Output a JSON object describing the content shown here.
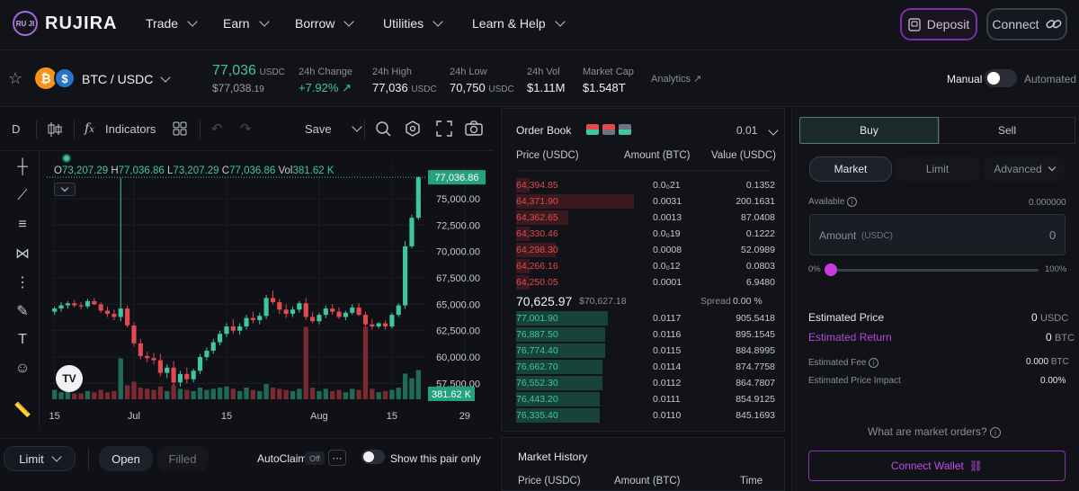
{
  "brand": {
    "name": "RUJIRA",
    "mark": "RU JI"
  },
  "nav": [
    {
      "label": "Trade"
    },
    {
      "label": "Earn"
    },
    {
      "label": "Borrow"
    },
    {
      "label": "Utilities"
    },
    {
      "label": "Learn & Help"
    }
  ],
  "header_buttons": {
    "deposit": "Deposit",
    "connect": "Connect"
  },
  "pair": {
    "name": "BTC / USDC"
  },
  "ticker": {
    "price": "77,036",
    "price_unit": "USDC",
    "price_sub": "$77,038.",
    "price_sub_small": "19",
    "change_label": "24h Change",
    "change_value": "+7.92%",
    "high_label": "24h High",
    "high_value": "77,036",
    "high_unit": "USDC",
    "low_label": "24h Low",
    "low_value": "70,750",
    "low_unit": "USDC",
    "vol_label": "24h Vol",
    "vol_value": "$1.11M",
    "mcap_label": "Market Cap",
    "mcap_value": "$1.548T",
    "analytics": "Analytics",
    "manual": "Manual",
    "automated": "Automated"
  },
  "chart_toolbar": {
    "interval": "D",
    "indicators": "Indicators",
    "save": "Save"
  },
  "chart_legend": {
    "o_label": "O",
    "o": "73,207.29",
    "h_label": "H",
    "h": "77,036.86",
    "l_label": "L",
    "l": "73,207.29",
    "c_label": "C",
    "c": "77,036.86",
    "vol_label": "Vol",
    "vol": "381.62 K"
  },
  "chart_data": {
    "type": "candlestick",
    "y_ticks": [
      "75,000.00",
      "72,500.00",
      "70,000.00",
      "67,500.00",
      "65,000.00",
      "62,500.00",
      "60,000.00",
      "57,500.00"
    ],
    "y_tick_values": [
      75000,
      72500,
      70000,
      67500,
      65000,
      62500,
      60000,
      57500
    ],
    "ylim": [
      56000,
      78500
    ],
    "x_ticks": [
      "15",
      "Jul",
      "15",
      "Aug",
      "15",
      "29"
    ],
    "last_price_label": "77,036.86",
    "volume_label": "381.62 K",
    "candles": [
      [
        64300,
        64800,
        64000,
        64600
      ],
      [
        64600,
        65200,
        64300,
        64900
      ],
      [
        64900,
        65300,
        64600,
        65100
      ],
      [
        65100,
        65400,
        64700,
        64900
      ],
      [
        64900,
        65200,
        64500,
        64800
      ],
      [
        64800,
        65500,
        64600,
        65300
      ],
      [
        65300,
        65600,
        64900,
        65000
      ],
      [
        65000,
        65200,
        64200,
        64400
      ],
      [
        64400,
        64800,
        63800,
        64100
      ],
      [
        64100,
        64500,
        63500,
        63800
      ],
      [
        63800,
        77000,
        63400,
        64600
      ],
      [
        64600,
        64900,
        62800,
        63000
      ],
      [
        63000,
        63300,
        61000,
        61300
      ],
      [
        61300,
        61700,
        59800,
        60100
      ],
      [
        60100,
        60500,
        59500,
        59900
      ],
      [
        59900,
        60400,
        59300,
        59700
      ],
      [
        59700,
        60300,
        58200,
        58500
      ],
      [
        58500,
        59300,
        58000,
        59000
      ],
      [
        59000,
        59600,
        57300,
        57600
      ],
      [
        57600,
        58700,
        57200,
        58400
      ],
      [
        58400,
        59000,
        57500,
        57900
      ],
      [
        57900,
        58900,
        57600,
        58700
      ],
      [
        58700,
        60300,
        58400,
        60000
      ],
      [
        60000,
        60900,
        59700,
        60600
      ],
      [
        60600,
        61700,
        60300,
        61400
      ],
      [
        61400,
        62500,
        61100,
        62200
      ],
      [
        62200,
        63200,
        61900,
        62900
      ],
      [
        62900,
        63600,
        62200,
        62500
      ],
      [
        62500,
        63200,
        62100,
        62900
      ],
      [
        62900,
        64000,
        62600,
        63700
      ],
      [
        63700,
        64300,
        63200,
        63500
      ],
      [
        63500,
        64200,
        63100,
        63900
      ],
      [
        63900,
        65900,
        63600,
        65600
      ],
      [
        65600,
        66300,
        65000,
        65200
      ],
      [
        65200,
        65500,
        64100,
        64500
      ],
      [
        64500,
        65000,
        63700,
        64100
      ],
      [
        64100,
        64800,
        63800,
        64500
      ],
      [
        64500,
        65300,
        64200,
        65100
      ],
      [
        65100,
        65600,
        63500,
        63800
      ],
      [
        63800,
        64300,
        63200,
        63400
      ],
      [
        63400,
        64200,
        63100,
        64000
      ],
      [
        64000,
        64900,
        63700,
        64600
      ],
      [
        64600,
        65000,
        64000,
        64300
      ],
      [
        64300,
        64700,
        63600,
        63800
      ],
      [
        63800,
        64400,
        63500,
        64200
      ],
      [
        64200,
        65000,
        64000,
        64700
      ],
      [
        64700,
        65100,
        63900,
        64000
      ],
      [
        64000,
        64300,
        62900,
        63100
      ],
      [
        63100,
        63600,
        62600,
        62900
      ],
      [
        62900,
        63300,
        62700,
        63200
      ],
      [
        63200,
        63500,
        62600,
        62900
      ],
      [
        62900,
        64200,
        62700,
        64000
      ],
      [
        64000,
        65100,
        63800,
        64900
      ],
      [
        64900,
        71000,
        64600,
        70500
      ],
      [
        70500,
        73500,
        70300,
        73200
      ],
      [
        73200,
        77100,
        73000,
        77036
      ]
    ],
    "volumes": [
      0.08,
      0.06,
      0.07,
      0.05,
      0.05,
      0.07,
      0.06,
      0.08,
      0.06,
      0.07,
      0.35,
      0.12,
      0.15,
      0.1,
      0.09,
      0.08,
      0.11,
      0.07,
      0.12,
      0.09,
      0.08,
      0.07,
      0.1,
      0.08,
      0.09,
      0.1,
      0.11,
      0.09,
      0.07,
      0.1,
      0.08,
      0.07,
      0.13,
      0.1,
      0.09,
      0.08,
      0.07,
      0.09,
      0.62,
      0.1,
      0.07,
      0.09,
      0.07,
      0.08,
      0.06,
      0.09,
      0.08,
      0.62,
      0.09,
      0.06,
      0.07,
      0.08,
      0.1,
      0.22,
      0.18,
      0.25
    ]
  },
  "bottom_bar": {
    "order_type": "Limit",
    "open": "Open",
    "filled": "Filled",
    "autoclaim": "AutoClaim",
    "autoclaim_state": "Off",
    "show_pair": "Show this pair only"
  },
  "order_book": {
    "title": "Order Book",
    "tick": "0.01",
    "headers": {
      "price": "Price (USDC)",
      "amount": "Amount (BTC)",
      "value": "Value (USDC)"
    },
    "asks": [
      {
        "price": "64,394.85",
        "amount": "0.0₀21",
        "value": "0.1352",
        "depth": 0.05
      },
      {
        "price": "64,371.90",
        "amount": "0.0031",
        "value": "200.1631",
        "depth": 0.45
      },
      {
        "price": "64,362.65",
        "amount": "0.0013",
        "value": "87.0408",
        "depth": 0.2
      },
      {
        "price": "64,330.46",
        "amount": "0.0₀19",
        "value": "0.1222",
        "depth": 0.05
      },
      {
        "price": "64,298.30",
        "amount": "0.0008",
        "value": "52.0989",
        "depth": 0.15
      },
      {
        "price": "64,266.16",
        "amount": "0.0₀12",
        "value": "0.0803",
        "depth": 0.05
      },
      {
        "price": "64,250.05",
        "amount": "0.0001",
        "value": "6.9480",
        "depth": 0.05
      }
    ],
    "mid_price": "70,625.97",
    "mid_usd": "$70,627.18",
    "spread_label": "Spread",
    "spread_value": "0.00 %",
    "bids": [
      {
        "price": "77,001.90",
        "amount": "0.0117",
        "value": "905.5418",
        "depth": 0.35
      },
      {
        "price": "76,887.50",
        "amount": "0.0116",
        "value": "895.1545",
        "depth": 0.34
      },
      {
        "price": "76,774.40",
        "amount": "0.0115",
        "value": "884.8995",
        "depth": 0.34
      },
      {
        "price": "76,662.70",
        "amount": "0.0114",
        "value": "874.7758",
        "depth": 0.33
      },
      {
        "price": "76,552.30",
        "amount": "0.0112",
        "value": "864.7807",
        "depth": 0.33
      },
      {
        "price": "76,443.20",
        "amount": "0.0111",
        "value": "854.9125",
        "depth": 0.32
      },
      {
        "price": "76,335.40",
        "amount": "0.0110",
        "value": "845.1693",
        "depth": 0.32
      }
    ]
  },
  "market_history": {
    "title": "Market History",
    "price": "Price (USDC)",
    "amount": "Amount (BTC)",
    "time": "Time"
  },
  "order_form": {
    "buy": "Buy",
    "sell": "Sell",
    "market": "Market",
    "limit": "Limit",
    "advanced": "Advanced",
    "available_label": "Available",
    "available_value": "0.000000",
    "amount_label": "Amount",
    "amount_unit": "(USDC)",
    "amount_value": "0",
    "slider_min": "0%",
    "slider_max": "100%",
    "est_price_label": "Estimated Price",
    "est_price_value": "0",
    "est_price_unit": "USDC",
    "est_return_label": "Estimated Return",
    "est_return_value": "0",
    "est_return_unit": "BTC",
    "est_fee_label": "Estimated Fee",
    "est_fee_value": "0.000",
    "est_fee_unit": "BTC",
    "impact_label": "Estimated Price Impact",
    "impact_value": "0.00%",
    "what_market": "What are market orders?",
    "connect_wallet": "Connect Wallet"
  },
  "colors": {
    "up": "#3ec79f",
    "down": "#e3494f",
    "accent": "#a63be0"
  }
}
